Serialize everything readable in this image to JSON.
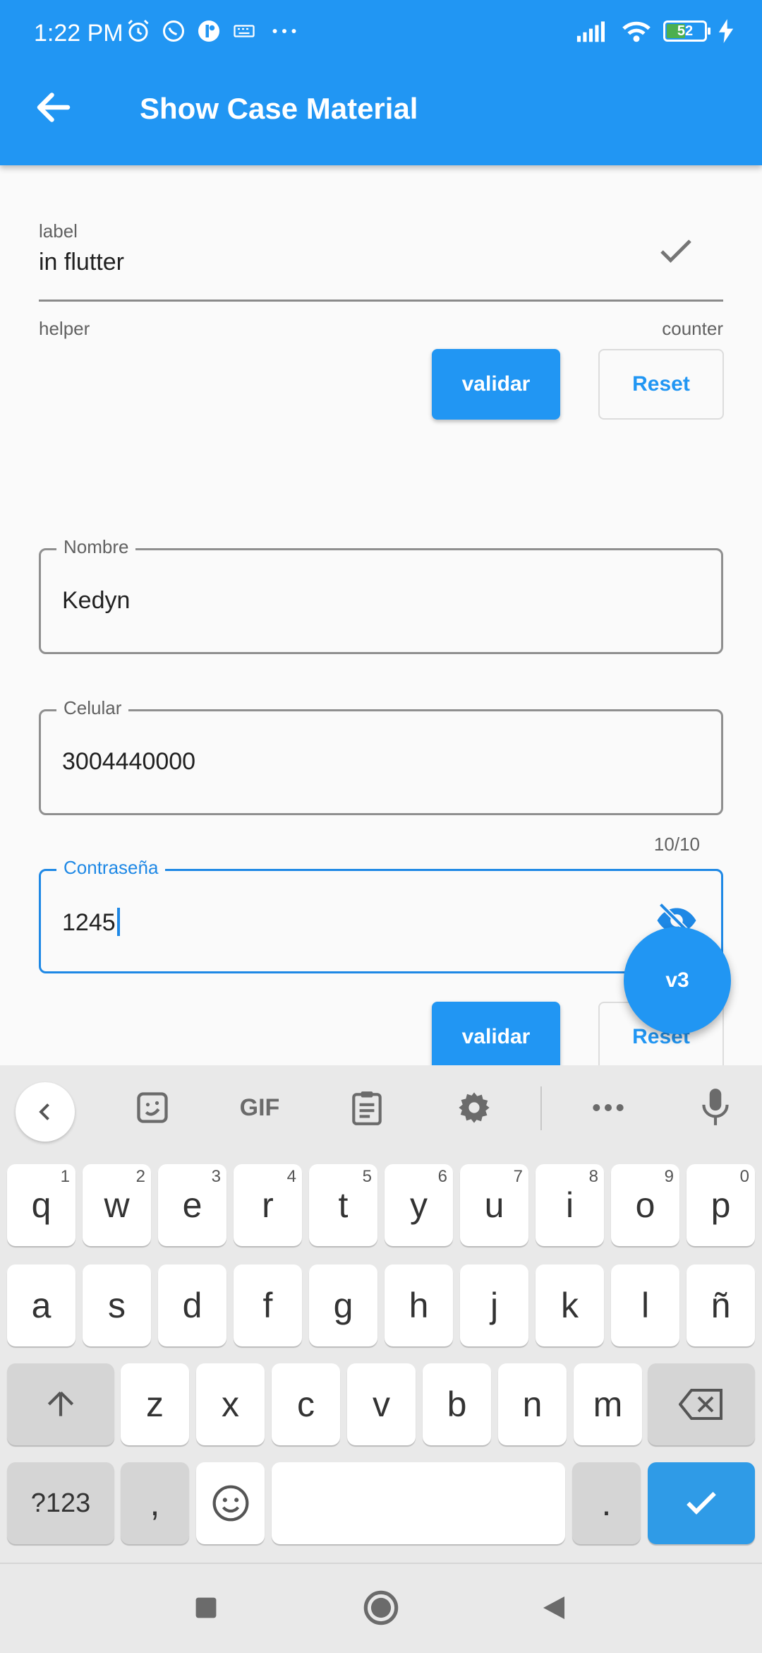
{
  "status_bar": {
    "time": "1:22 PM",
    "battery": "52",
    "icons": [
      "alarm-icon",
      "whatsapp-icon",
      "app-icon",
      "keyboard-icon",
      "more-icon",
      "signal-icon",
      "wifi-icon",
      "battery-icon",
      "charging-icon"
    ]
  },
  "app_bar": {
    "title": "Show Case Material",
    "back_icon": "arrow-left-icon",
    "color": "#2196f3"
  },
  "form_top": {
    "label": "label",
    "value": "in flutter",
    "helper": "helper",
    "counter": "counter",
    "suffix_icon": "check-icon",
    "validate_label": "validar",
    "reset_label": "Reset"
  },
  "fields": {
    "nombre": {
      "label": "Nombre",
      "value": "Kedyn"
    },
    "celular": {
      "label": "Celular",
      "value": "3004440000",
      "counter": "10/10"
    },
    "contrasena": {
      "label": "Contraseña",
      "value": "1245",
      "suffix_icon": "visibility-off-icon"
    }
  },
  "form_bottom": {
    "validate_label": "validar",
    "reset_label": "Reset"
  },
  "fab": {
    "label": "v3"
  },
  "keyboard": {
    "toolbar": [
      "chevron-left-icon",
      "sticker-icon",
      "GIF",
      "clipboard-icon",
      "gear-icon",
      "more-icon",
      "mic-icon"
    ],
    "row1": [
      {
        "k": "q",
        "h": "1"
      },
      {
        "k": "w",
        "h": "2"
      },
      {
        "k": "e",
        "h": "3"
      },
      {
        "k": "r",
        "h": "4"
      },
      {
        "k": "t",
        "h": "5"
      },
      {
        "k": "y",
        "h": "6"
      },
      {
        "k": "u",
        "h": "7"
      },
      {
        "k": "i",
        "h": "8"
      },
      {
        "k": "o",
        "h": "9"
      },
      {
        "k": "p",
        "h": "0"
      }
    ],
    "row2": [
      "a",
      "s",
      "d",
      "f",
      "g",
      "h",
      "j",
      "k",
      "l",
      "ñ"
    ],
    "row3": [
      "z",
      "x",
      "c",
      "v",
      "b",
      "n",
      "m"
    ],
    "row4": {
      "symbols": "?123",
      "comma": ",",
      "period": "."
    }
  },
  "nav_bar": [
    "recents-icon",
    "home-icon",
    "back-icon"
  ]
}
